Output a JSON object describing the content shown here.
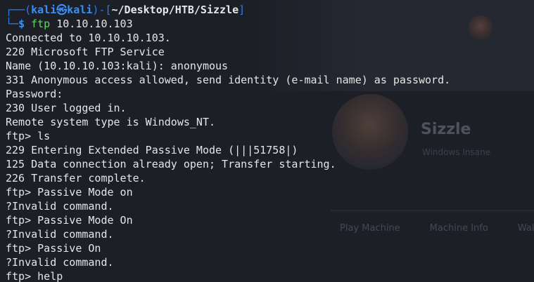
{
  "prompt": {
    "corner_top": "┌──(",
    "user": "kali",
    "at_symbol": "㉿",
    "host": "kali",
    "mid": ")-[",
    "cwd": "~/Desktop/HTB/Sizzle",
    "close": "]",
    "corner_bottom": "└─",
    "dollar": "$",
    "command_name": "ftp",
    "command_args": " 10.10.10.103"
  },
  "output_lines": [
    "Connected to 10.10.10.103.",
    "220 Microsoft FTP Service",
    "Name (10.10.10.103:kali): anonymous",
    "331 Anonymous access allowed, send identity (e-mail name) as password.",
    "Password:",
    "230 User logged in.",
    "Remote system type is Windows_NT.",
    "ftp> ls",
    "229 Entering Extended Passive Mode (|||51758|)",
    "125 Data connection already open; Transfer starting.",
    "226 Transfer complete.",
    "ftp> Passive Mode on",
    "?Invalid command.",
    "ftp> Passive Mode On",
    "?Invalid command.",
    "ftp> Passive On",
    "?Invalid command.",
    "ftp> help"
  ],
  "background": {
    "title": "Sizzle",
    "subtitle": "Windows     Insane",
    "tabs": [
      "Play Machine",
      "Machine Info",
      "Walkthr"
    ]
  },
  "colors": {
    "terminal_bg": "#1d1f27",
    "text": "#e6e6e6",
    "prompt_blue": "#3b8ff5",
    "command_green": "#5fd45f"
  }
}
